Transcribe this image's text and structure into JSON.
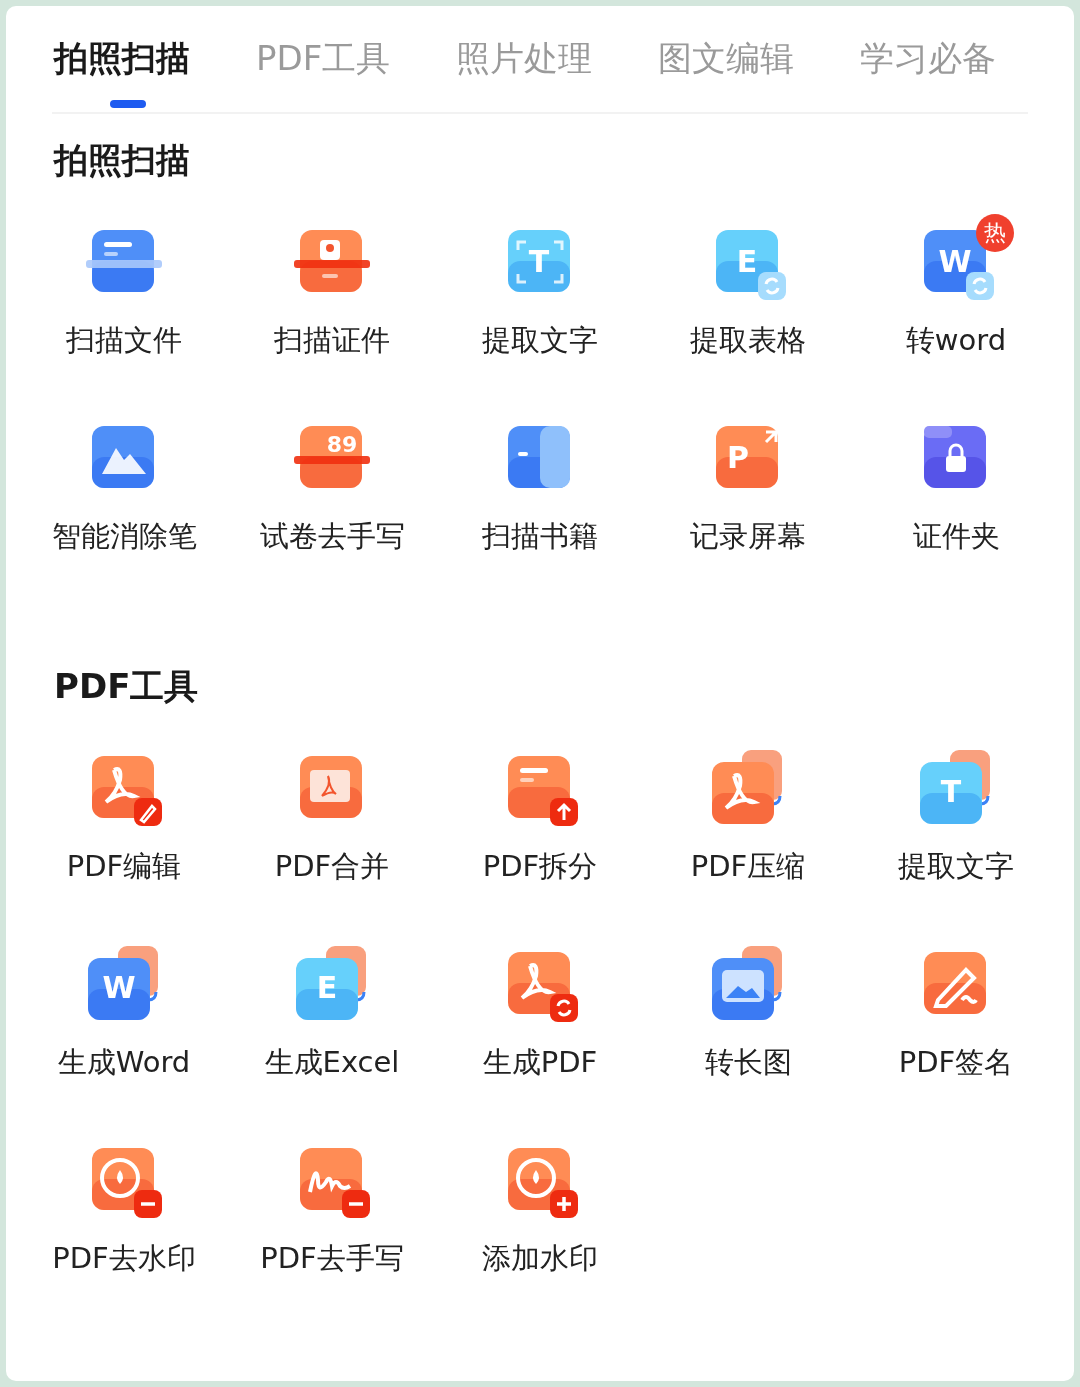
{
  "tabs": [
    {
      "label": "拍照扫描",
      "selected": true
    },
    {
      "label": "PDF工具",
      "selected": false
    },
    {
      "label": "照片处理",
      "selected": false
    },
    {
      "label": "图文编辑",
      "selected": false
    },
    {
      "label": "学习必备",
      "selected": false
    }
  ],
  "sections": [
    {
      "title": "拍照扫描",
      "items": [
        {
          "label": "扫描文件",
          "kind": "document"
        },
        {
          "label": "扫描证件",
          "kind": "idcard"
        },
        {
          "label": "提取文字",
          "kind": "textscan",
          "icon_text": "T"
        },
        {
          "label": "提取表格",
          "kind": "tableextract",
          "icon_text": "E"
        },
        {
          "label": "转word",
          "kind": "wordconvert",
          "icon_text": "W",
          "badge": "热"
        },
        {
          "label": "智能消除笔",
          "kind": "eraser"
        },
        {
          "label": "试卷去手写",
          "kind": "exam",
          "icon_text": "89"
        },
        {
          "label": "扫描书籍",
          "kind": "book"
        },
        {
          "label": "记录屏幕",
          "kind": "record",
          "icon_text": "P"
        },
        {
          "label": "证件夹",
          "kind": "folder"
        }
      ]
    },
    {
      "title": "PDF工具",
      "items": [
        {
          "label": "PDF编辑",
          "kind": "pdfedit"
        },
        {
          "label": "PDF合并",
          "kind": "pdfmerge"
        },
        {
          "label": "PDF拆分",
          "kind": "pdfsplit"
        },
        {
          "label": "PDF压缩",
          "kind": "pdfcompress"
        },
        {
          "label": "提取文字",
          "kind": "textexport",
          "icon_text": "T"
        },
        {
          "label": "生成Word",
          "kind": "wordexport",
          "icon_text": "W"
        },
        {
          "label": "生成Excel",
          "kind": "excelexport",
          "icon_text": "E"
        },
        {
          "label": "生成PDF",
          "kind": "pdfexport"
        },
        {
          "label": "转长图",
          "kind": "longimage"
        },
        {
          "label": "PDF签名",
          "kind": "sign"
        },
        {
          "label": "PDF去水印",
          "kind": "unwatermark"
        },
        {
          "label": "PDF去手写",
          "kind": "unhandwrite"
        },
        {
          "label": "添加水印",
          "kind": "watermark"
        }
      ]
    }
  ]
}
